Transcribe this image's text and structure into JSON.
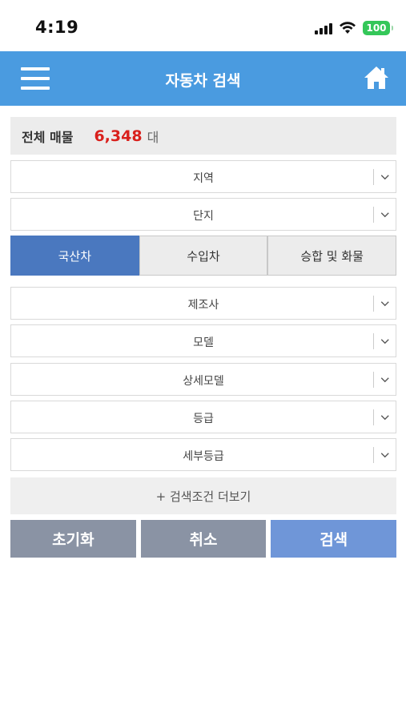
{
  "status_bar": {
    "time": "4:19",
    "battery": "100"
  },
  "header": {
    "title": "자동차 검색",
    "menu_icon": "hamburger-icon",
    "home_icon": "home-icon"
  },
  "summary": {
    "label": "전체 매물",
    "count": "6,348",
    "unit": "대"
  },
  "filters": {
    "region": "지역",
    "complex": "단지",
    "manufacturer": "제조사",
    "model": "모델",
    "detail_model": "상세모델",
    "grade": "등급",
    "detail_grade": "세부등급"
  },
  "car_type_tabs": [
    {
      "label": "국산차",
      "active": true
    },
    {
      "label": "수입차",
      "active": false
    },
    {
      "label": "승합 및 화물",
      "active": false
    }
  ],
  "more_conditions": "+ 검색조건 더보기",
  "actions": {
    "reset": "초기화",
    "cancel": "취소",
    "search": "검색"
  },
  "colors": {
    "header": "#4a9be0",
    "active_tab": "#4a78bf",
    "count": "#d9201c",
    "search_button": "#6f96d8",
    "gray_button": "#8a93a4"
  }
}
